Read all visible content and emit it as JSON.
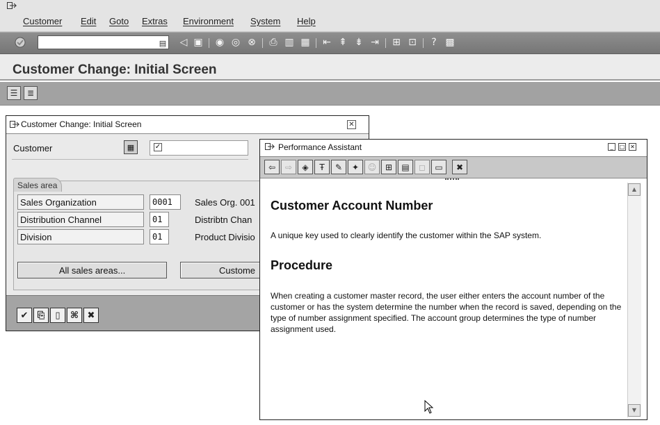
{
  "menubar": {
    "items": [
      "Customer",
      "Edit",
      "Goto",
      "Extras",
      "Environment",
      "System",
      "Help"
    ]
  },
  "toolbar": {
    "okcode_value": "",
    "icons": [
      "enter-icon",
      "command-field-history-icon",
      "back-triangle-icon",
      "save-icon",
      "back-icon",
      "exit-icon",
      "cancel-icon",
      "print-icon",
      "find-icon",
      "find-next-icon",
      "first-page-icon",
      "previous-page-icon",
      "next-page-icon",
      "last-page-icon",
      "create-session-icon",
      "shortcut-icon",
      "help-icon",
      "layout-menu-icon"
    ]
  },
  "page": {
    "title": "Customer Change: Initial Screen"
  },
  "dialog": {
    "title": "Customer Change: Initial Screen",
    "customer_label": "Customer",
    "customer_value": "",
    "sales_area_tab": "Sales area",
    "rows": [
      {
        "label": "Sales Organization",
        "value": "0001",
        "desc": "Sales Org. 001"
      },
      {
        "label": "Distribution Channel",
        "value": "01",
        "desc": "Distribtn Chan"
      },
      {
        "label": "Division",
        "value": "01",
        "desc": "Product Divisio"
      }
    ],
    "buttons": {
      "all_sales_areas": "All sales areas...",
      "customer_partial": "Custome"
    }
  },
  "performance_assistant": {
    "title": "Performance Assistant",
    "heading1": "Customer Account Number",
    "para1": "A unique key used to clearly identify the customer within the SAP system.",
    "heading2": "Procedure",
    "para2": "When creating a customer master record, the user either enters the account number of the customer or has the system determine the number when the record is saved, depending on the type of number assignment specified. The account group determines the type of number assignment used."
  }
}
